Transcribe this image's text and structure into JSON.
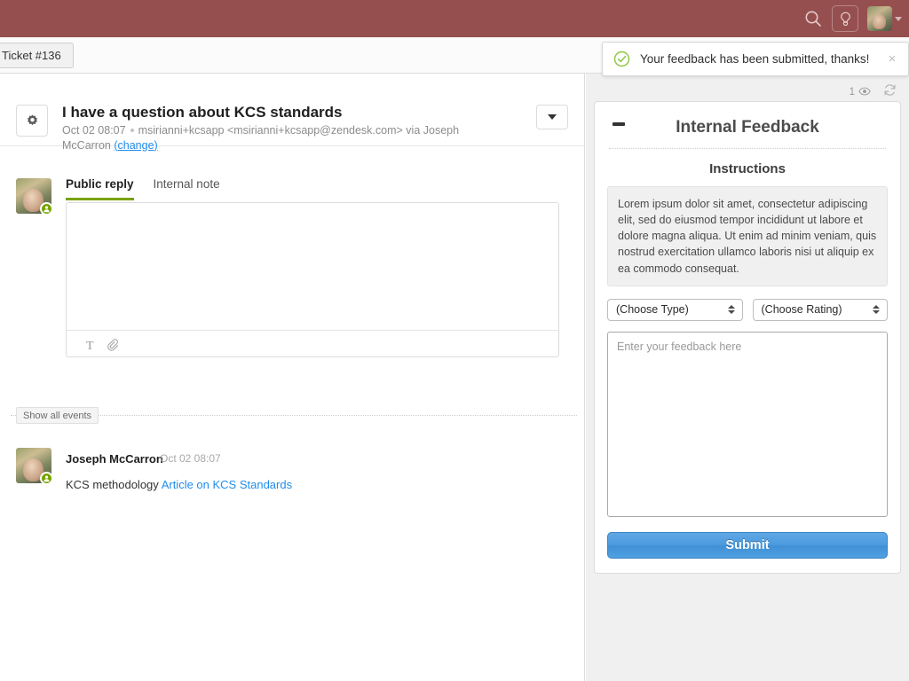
{
  "topbar": {
    "search_icon": "search-icon",
    "phone_icon": "phone-icon",
    "avatar_icon": "user-avatar",
    "caret_icon": "chevron-down-icon"
  },
  "tabstrip": {
    "ticket_tab_label": "Ticket #136"
  },
  "toast": {
    "message": "Your feedback has been submitted, thanks!",
    "close_label": "×",
    "check_icon": "check-circle-icon",
    "accent_color": "#78a300"
  },
  "ticket": {
    "gear_icon": "gear-icon",
    "title": "I have a question about KCS standards",
    "meta_time": "Oct 02 08:07",
    "meta_from": "msirianni+kcsapp <msirianni+kcsapp@zendesk.com> via Joseph McCarron",
    "change_link": "(change)",
    "caret_icon": "chevron-down-icon"
  },
  "composer": {
    "tabs": [
      {
        "label": "Public reply",
        "active": true
      },
      {
        "label": "Internal note",
        "active": false
      }
    ],
    "reply_value": "",
    "reply_placeholder": "",
    "text_tool_icon": "text-format-icon",
    "attach_icon": "paperclip-icon",
    "avatar_badge_icon": "end-user-badge-icon"
  },
  "events": {
    "show_all_label": "Show all events",
    "items": [
      {
        "author": "Joseph McCarron",
        "time": "Oct 02 08:07",
        "body_text": "KCS methodology ",
        "link_text": "Article on KCS Standards"
      }
    ]
  },
  "sidebar": {
    "watch_count": "1",
    "watch_icon": "eye-icon",
    "refresh_icon": "refresh-icon",
    "feedback_app": {
      "collapse_icon": "minus-icon",
      "title": "Internal Feedback",
      "instructions_heading": "Instructions",
      "instructions_text": "Lorem ipsum dolor sit amet, consectetur adipiscing elit, sed do eiusmod tempor incididunt ut labore et dolore magna aliqua. Ut enim ad minim veniam, quis nostrud exercitation ullamco laboris nisi ut aliquip ex ea commodo consequat.",
      "type_select": "(Choose Type)",
      "rating_select": "(Choose Rating)",
      "feedback_value": "",
      "feedback_placeholder": "Enter your feedback here",
      "submit_label": "Submit",
      "submit_color": "#4b9ade"
    }
  }
}
